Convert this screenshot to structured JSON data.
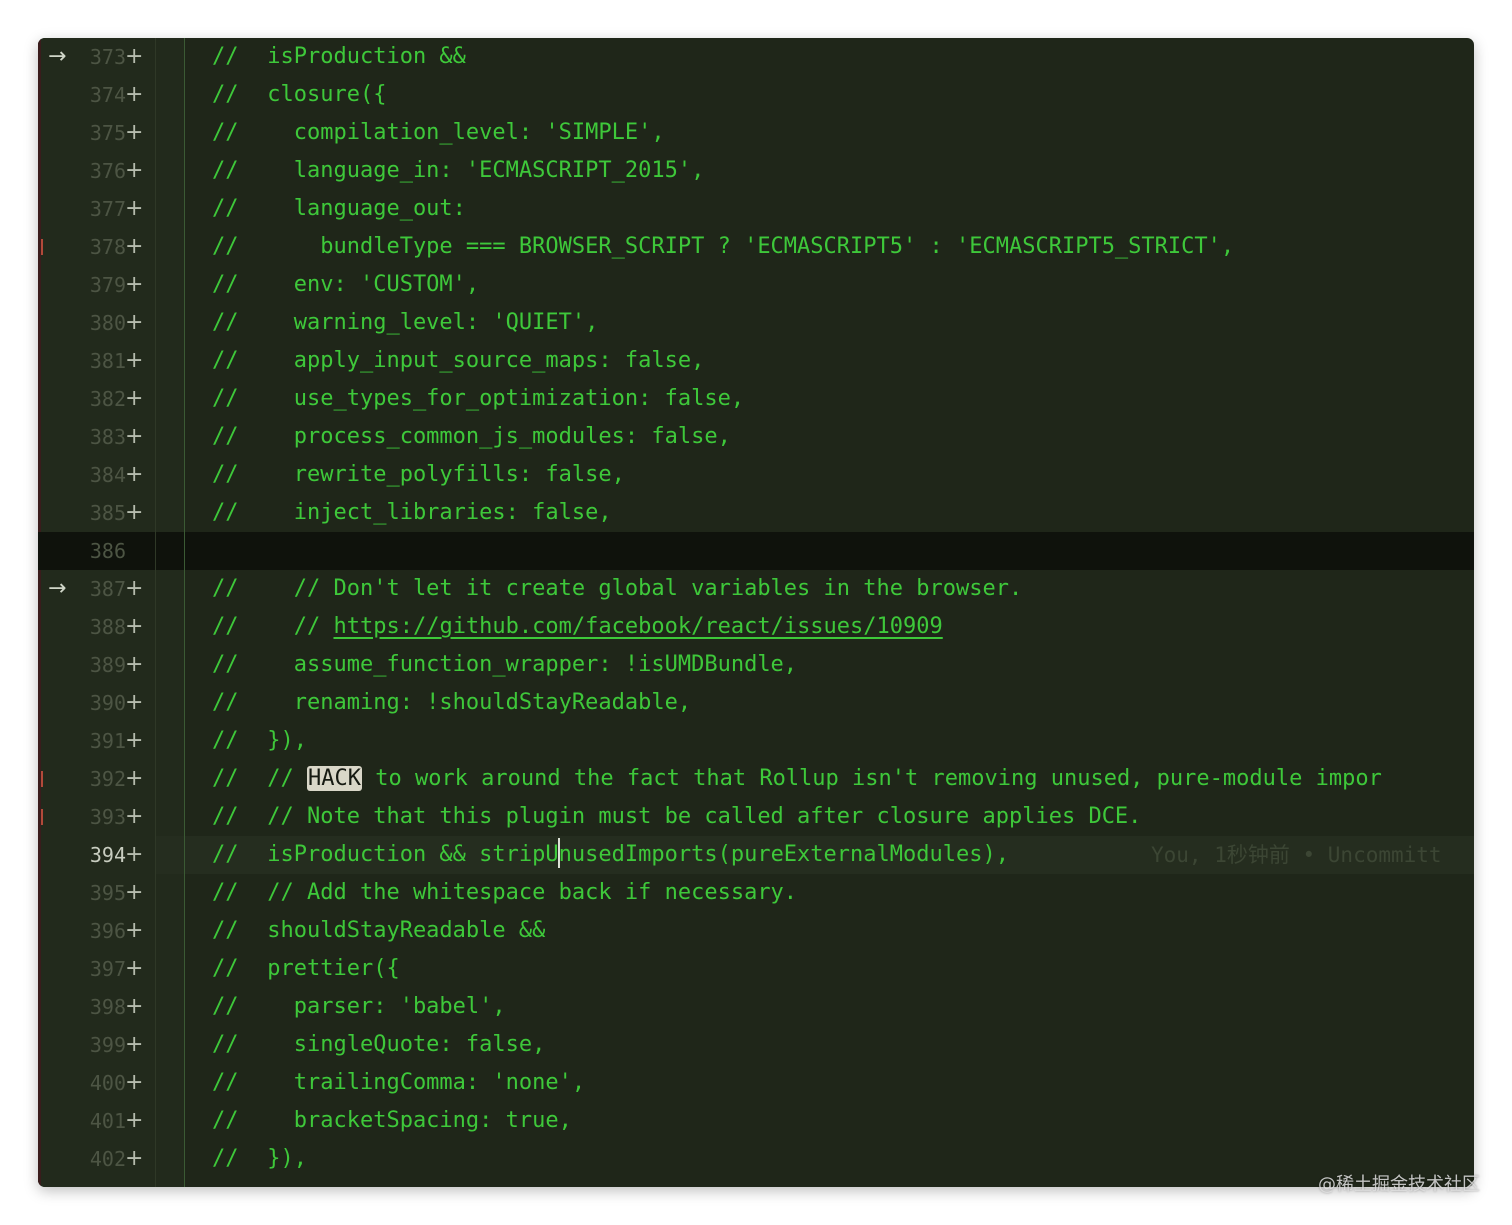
{
  "editor": {
    "lines": [
      {
        "num": "373",
        "marker": "+",
        "arrow": true,
        "sigil": "//",
        "code": " isProduction &&"
      },
      {
        "num": "374",
        "marker": "+",
        "sigil": "//",
        "code": " closure({"
      },
      {
        "num": "375",
        "marker": "+",
        "sigil": "//",
        "code": "   compilation_level: 'SIMPLE',"
      },
      {
        "num": "376",
        "marker": "+",
        "sigil": "//",
        "code": "   language_in: 'ECMASCRIPT_2015',"
      },
      {
        "num": "377",
        "marker": "+",
        "sigil": "//",
        "code": "   language_out:"
      },
      {
        "num": "378",
        "marker": "+",
        "sigil": "//",
        "code": "     bundleType === BROWSER_SCRIPT ? 'ECMASCRIPT5' : 'ECMASCRIPT5_STRICT',"
      },
      {
        "num": "379",
        "marker": "+",
        "sigil": "//",
        "code": "   env: 'CUSTOM',"
      },
      {
        "num": "380",
        "marker": "+",
        "sigil": "//",
        "code": "   warning_level: 'QUIET',"
      },
      {
        "num": "381",
        "marker": "+",
        "sigil": "//",
        "code": "   apply_input_source_maps: false,"
      },
      {
        "num": "382",
        "marker": "+",
        "sigil": "//",
        "code": "   use_types_for_optimization: false,"
      },
      {
        "num": "383",
        "marker": "+",
        "sigil": "//",
        "code": "   process_common_js_modules: false,"
      },
      {
        "num": "384",
        "marker": "+",
        "sigil": "//",
        "code": "   rewrite_polyfills: false,"
      },
      {
        "num": "385",
        "marker": "+",
        "sigil": "//",
        "code": "   inject_libraries: false,"
      },
      {
        "num": "386",
        "marker": "",
        "sigil": "",
        "code": "",
        "empty": true
      },
      {
        "num": "387",
        "marker": "+",
        "arrow": true,
        "sigil": "//",
        "code": "   // Don't let it create global variables in the browser."
      },
      {
        "num": "388",
        "marker": "+",
        "sigil": "//",
        "code": "   // ",
        "link": "https://github.com/facebook/react/issues/10909"
      },
      {
        "num": "389",
        "marker": "+",
        "sigil": "//",
        "code": "   assume_function_wrapper: !isUMDBundle,"
      },
      {
        "num": "390",
        "marker": "+",
        "sigil": "//",
        "code": "   renaming: !shouldStayReadable,"
      },
      {
        "num": "391",
        "marker": "+",
        "sigil": "//",
        "code": " }),"
      },
      {
        "num": "392",
        "marker": "+",
        "sigil": "//",
        "code": " // ",
        "hack": "HACK",
        "code_after": " to work around the fact that Rollup isn't removing unused, pure-module impor"
      },
      {
        "num": "393",
        "marker": "+",
        "sigil": "//",
        "code": " // Note that this plugin must be called after closure applies DCE."
      },
      {
        "num": "394",
        "marker": "+",
        "current": true,
        "sigil": "//",
        "code": " isProduction && stripU",
        "code_after_cursor": "nusedImports(pureExternalModules),",
        "blame": "You, 1秒钟前 • Uncommitt"
      },
      {
        "num": "395",
        "marker": "+",
        "sigil": "//",
        "code": " // Add the whitespace back if necessary."
      },
      {
        "num": "396",
        "marker": "+",
        "sigil": "//",
        "code": " shouldStayReadable &&"
      },
      {
        "num": "397",
        "marker": "+",
        "sigil": "//",
        "code": " prettier({"
      },
      {
        "num": "398",
        "marker": "+",
        "sigil": "//",
        "code": "   parser: 'babel',"
      },
      {
        "num": "399",
        "marker": "+",
        "sigil": "//",
        "code": "   singleQuote: false,"
      },
      {
        "num": "400",
        "marker": "+",
        "sigil": "//",
        "code": "   trailingComma: 'none',"
      },
      {
        "num": "401",
        "marker": "+",
        "sigil": "//",
        "code": "   bracketSpacing: true,"
      },
      {
        "num": "402",
        "marker": "+",
        "sigil": "//",
        "code": " }),"
      }
    ]
  },
  "watermark": "@稀土掘金技术社区",
  "colors": {
    "code_green": "#3ec83a",
    "background": "#1f2619",
    "line_number": "#4d5544"
  }
}
